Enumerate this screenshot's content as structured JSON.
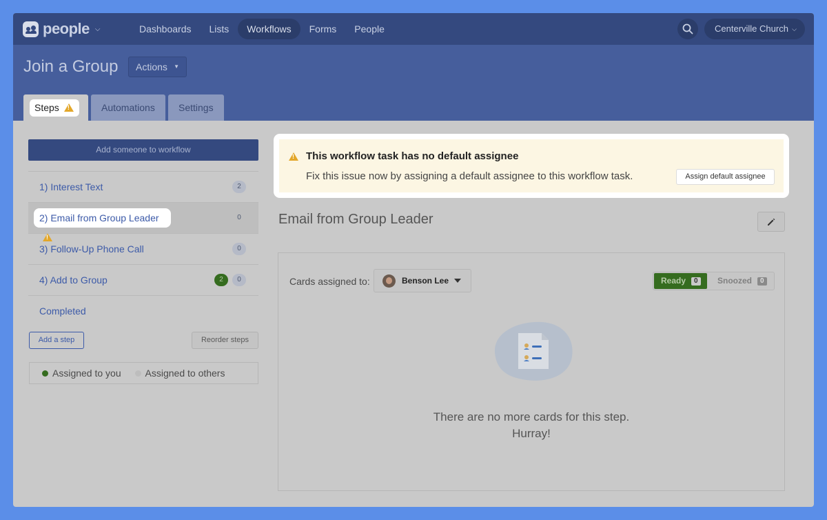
{
  "app": {
    "logo_text": "people",
    "nav": [
      "Dashboards",
      "Lists",
      "Workflows",
      "Forms",
      "People"
    ],
    "active_nav": "Workflows",
    "org_name": "Centerville Church"
  },
  "header": {
    "title": "Join a Group",
    "actions_label": "Actions",
    "tabs": {
      "steps": "Steps",
      "automations": "Automations",
      "settings": "Settings"
    }
  },
  "sidebar": {
    "add_button": "Add someone to workflow",
    "steps": [
      {
        "label": "1) Interest Text",
        "count": "2"
      },
      {
        "label": "2) Email from Group Leader",
        "count": "0"
      },
      {
        "label": "3) Follow-Up Phone Call",
        "count": "0"
      },
      {
        "label": "4) Add to Group",
        "ready": "2",
        "count": "0"
      }
    ],
    "completed_label": "Completed",
    "add_step": "Add a step",
    "reorder_steps": "Reorder steps",
    "legend": {
      "assigned_you": "Assigned to you",
      "assigned_others": "Assigned to others"
    }
  },
  "alert": {
    "title": "This workflow task has no default assignee",
    "message": "Fix this issue now by assigning a default assignee to this workflow task.",
    "button": "Assign default assignee"
  },
  "main": {
    "step_title": "Email from Group Leader",
    "cards_assigned_label": "Cards assigned to:",
    "assignee": "Benson Lee",
    "ready_label": "Ready",
    "ready_count": "0",
    "snoozed_label": "Snoozed",
    "snoozed_count": "0",
    "empty_line1": "There are no more cards for this step.",
    "empty_line2": "Hurray!"
  },
  "colors": {
    "nav_bg": "#34497f",
    "header_bg": "#465e9c",
    "link": "#3c5aa8",
    "success": "#356c1f",
    "warning": "#e3a72a",
    "alert_bg": "#fcf6e3"
  }
}
